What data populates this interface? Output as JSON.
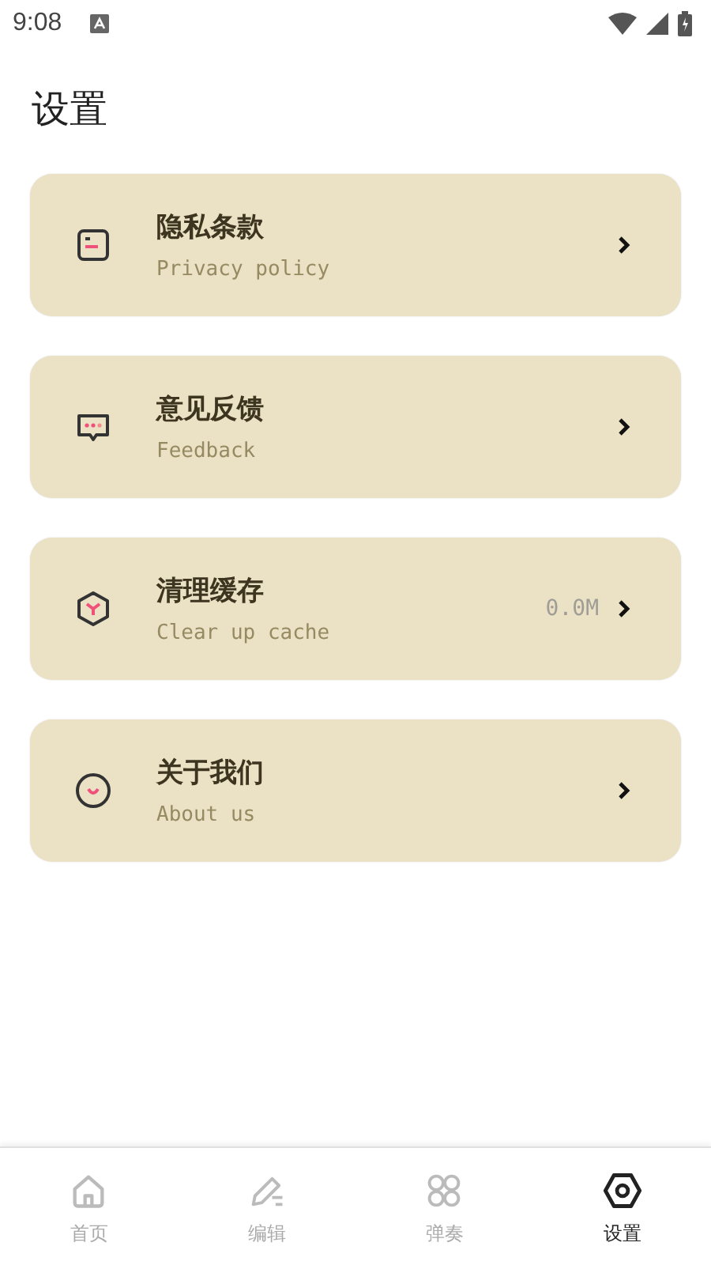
{
  "status_bar": {
    "time": "9:08"
  },
  "title": "设置",
  "items": [
    {
      "kind": "document",
      "title": "隐私条款",
      "subtitle": "Privacy policy"
    },
    {
      "kind": "chat",
      "title": "意见反馈",
      "subtitle": "Feedback"
    },
    {
      "kind": "cube",
      "title": "清理缓存",
      "subtitle": "Clear up cache",
      "value": "0.0M"
    },
    {
      "kind": "smile",
      "title": "关于我们",
      "subtitle": "About us"
    }
  ],
  "tabs": [
    {
      "kind": "home",
      "label": "首页",
      "selected": false
    },
    {
      "kind": "edit",
      "label": "编辑",
      "selected": false
    },
    {
      "kind": "grid",
      "label": "弹奏",
      "selected": false
    },
    {
      "kind": "settings",
      "label": "设置",
      "selected": true
    }
  ]
}
